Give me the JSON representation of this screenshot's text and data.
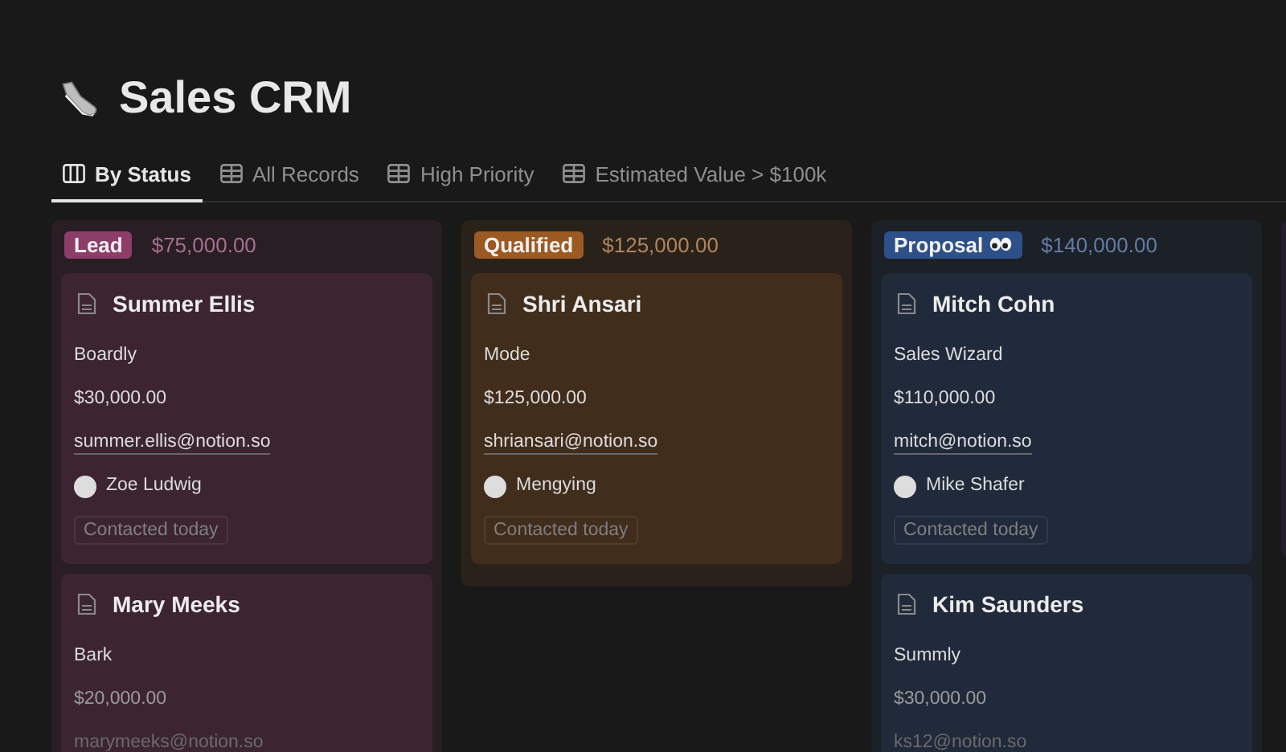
{
  "page": {
    "title": "Sales CRM"
  },
  "tabs": [
    {
      "label": "By Status",
      "kind": "board",
      "selected": true
    },
    {
      "label": "All Records",
      "kind": "table",
      "selected": false
    },
    {
      "label": "High Priority",
      "kind": "table",
      "selected": false
    },
    {
      "label": "Estimated Value > $100k",
      "kind": "table",
      "selected": false
    }
  ],
  "columns": [
    {
      "status": "Lead",
      "total": "$75,000.00",
      "color": "#8c3d68",
      "cards": [
        {
          "name": "Summer Ellis",
          "company": "Boardly",
          "value": "$30,000.00",
          "email": "summer.ellis@notion.so",
          "owner": "Zoe Ludwig",
          "tag": "Contacted today"
        },
        {
          "name": "Mary Meeks",
          "company": "Bark",
          "value": "$20,000.00",
          "email": "marymeeks@notion.so"
        }
      ]
    },
    {
      "status": "Qualified",
      "total": "$125,000.00",
      "color": "#9b5a22",
      "cards": [
        {
          "name": "Shri Ansari",
          "company": "Mode",
          "value": "$125,000.00",
          "email": "shriansari@notion.so",
          "owner": "Mengying",
          "tag": "Contacted today"
        }
      ]
    },
    {
      "status": "Proposal",
      "eyes": true,
      "total": "$140,000.00",
      "color": "#2d5088",
      "cards": [
        {
          "name": "Mitch Cohn",
          "company": "Sales Wizard",
          "value": "$110,000.00",
          "email": "mitch@notion.so",
          "owner": "Mike Shafer",
          "tag": "Contacted today"
        },
        {
          "name": "Kim Saunders",
          "company": "Summly",
          "value": "$30,000.00",
          "email": "ks12@notion.so"
        }
      ]
    }
  ]
}
